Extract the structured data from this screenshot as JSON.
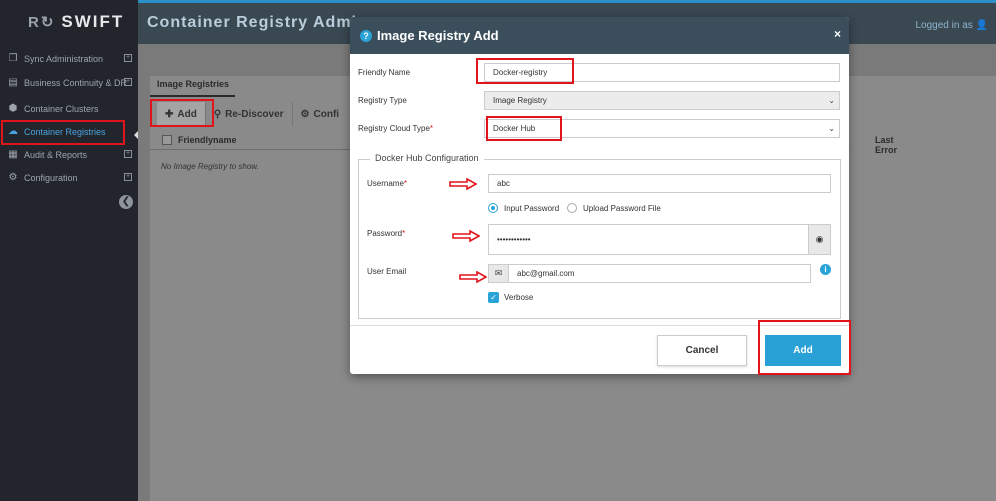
{
  "app": {
    "logo_mark": "R↻",
    "logo_text": "SWIFT"
  },
  "sidebar": {
    "items": [
      {
        "label": "Sync Administration",
        "icon": "copy-icon",
        "expandable": true
      },
      {
        "label": "Business Continuity & DR",
        "icon": "server-icon",
        "expandable": true
      },
      {
        "label": "Container Clusters",
        "icon": "cube-icon",
        "expandable": false
      },
      {
        "label": "Container Registries",
        "icon": "cloud-icon",
        "expandable": false,
        "active": true
      },
      {
        "label": "Audit & Reports",
        "icon": "table-icon",
        "expandable": true
      },
      {
        "label": "Configuration",
        "icon": "gears-icon",
        "expandable": true
      }
    ]
  },
  "header": {
    "title": "Container Registry Admin",
    "logged_in": "Logged in as"
  },
  "page": {
    "tab": "Image Registries",
    "toolbar": {
      "add": "Add",
      "rediscover": "Re-Discover",
      "config": "Confi"
    },
    "grid": {
      "col_friendlyname": "Friendlyname",
      "col_last_error": "Last Error",
      "empty": "No Image Registry to show."
    }
  },
  "modal": {
    "title": "Image Registry Add",
    "close": "×",
    "friendly_name": {
      "label": "Friendly Name",
      "value": "Docker-registry"
    },
    "registry_type": {
      "label": "Registry Type",
      "value": "Image Registry"
    },
    "cloud_type": {
      "label": "Registry Cloud Type",
      "required": "*",
      "value": "Docker Hub"
    },
    "section_title": "Docker Hub Configuration",
    "username": {
      "label": "Username",
      "required": "*",
      "value": "abc"
    },
    "password_mode": {
      "option1": "Input Password",
      "option2": "Upload Password File",
      "selected": "Input Password"
    },
    "password": {
      "label": "Password",
      "required": "*",
      "value": "••••••••••••"
    },
    "email": {
      "label": "User Email",
      "value": "abc@gmail.com"
    },
    "verbose": {
      "label": "Verbose",
      "checked": true
    },
    "cancel": "Cancel",
    "add": "Add"
  },
  "colors": {
    "accent": "#2aa1d6",
    "header": "#3b4e5c",
    "sidebar": "#22262c",
    "annotation": "#e0141b"
  }
}
